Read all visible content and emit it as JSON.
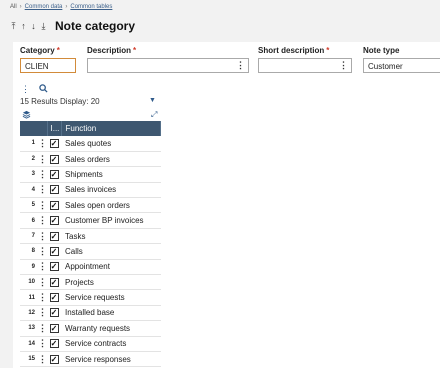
{
  "breadcrumb": [
    "All",
    "Common data",
    "Common tables"
  ],
  "title": "Note category",
  "fields": {
    "category": {
      "label": "Category",
      "value": "CLIEN"
    },
    "description": {
      "label": "Description",
      "value": ""
    },
    "short_description": {
      "label": "Short description",
      "value": ""
    },
    "note_type": {
      "label": "Note type",
      "value": "Customer"
    }
  },
  "list": {
    "results_text": "15 Results",
    "display_label": "Display:",
    "display_value": "20",
    "columns": [
      "I...",
      "Function"
    ],
    "rows": [
      {
        "num": "1",
        "function": "Sales quotes"
      },
      {
        "num": "2",
        "function": "Sales orders"
      },
      {
        "num": "3",
        "function": "Shipments"
      },
      {
        "num": "4",
        "function": "Sales invoices"
      },
      {
        "num": "5",
        "function": "Sales open orders"
      },
      {
        "num": "6",
        "function": "Customer BP invoices"
      },
      {
        "num": "7",
        "function": "Tasks"
      },
      {
        "num": "8",
        "function": "Calls"
      },
      {
        "num": "9",
        "function": "Appointment"
      },
      {
        "num": "10",
        "function": "Projects"
      },
      {
        "num": "11",
        "function": "Service requests"
      },
      {
        "num": "12",
        "function": "Installed base"
      },
      {
        "num": "13",
        "function": "Warranty requests"
      },
      {
        "num": "14",
        "function": "Service contracts"
      },
      {
        "num": "15",
        "function": "Service responses"
      }
    ]
  },
  "colors": {
    "header_bg": "#3e5770",
    "required": "#d13b2b",
    "active_field": "#d28b3a"
  }
}
